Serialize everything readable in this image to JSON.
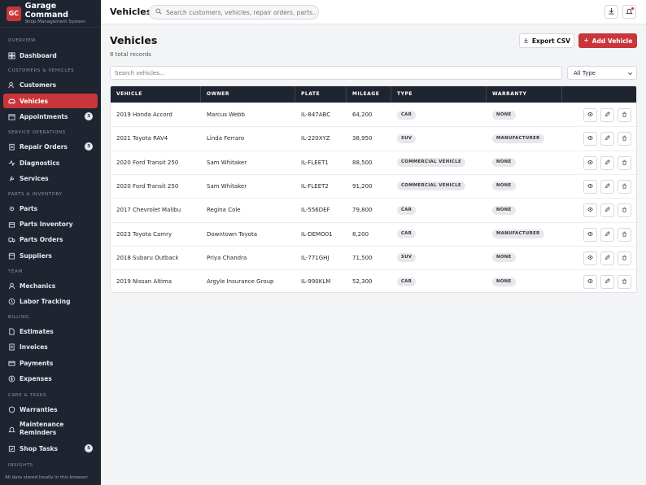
{
  "brand": {
    "logo": "GC",
    "title": "Garage Command",
    "subtitle": "Shop Management System"
  },
  "sidebar": {
    "sections": [
      "OVERVIEW",
      "CUSTOMERS & VEHICLES",
      "SERVICE OPERATIONS",
      "PARTS & INVENTORY",
      "TEAM",
      "BILLING",
      "CARE & TASKS",
      "INSIGHTS"
    ],
    "items": [
      {
        "label": "Dashboard",
        "icon": "dashboard-icon"
      },
      {
        "label": "Customers",
        "icon": "users-icon"
      },
      {
        "label": "Vehicles",
        "icon": "car-icon",
        "active": true
      },
      {
        "label": "Appointments",
        "icon": "calendar-icon",
        "badge": "3"
      },
      {
        "label": "Repair Orders",
        "icon": "clipboard-icon",
        "badge": "3"
      },
      {
        "label": "Diagnostics",
        "icon": "pulse-icon"
      },
      {
        "label": "Services",
        "icon": "wrench-icon"
      },
      {
        "label": "Parts",
        "icon": "gear-icon"
      },
      {
        "label": "Parts Inventory",
        "icon": "box-icon"
      },
      {
        "label": "Parts Orders",
        "icon": "truck-icon"
      },
      {
        "label": "Suppliers",
        "icon": "store-icon"
      },
      {
        "label": "Mechanics",
        "icon": "person-icon"
      },
      {
        "label": "Labor Tracking",
        "icon": "clock-icon"
      },
      {
        "label": "Estimates",
        "icon": "document-icon"
      },
      {
        "label": "Invoices",
        "icon": "invoice-icon"
      },
      {
        "label": "Payments",
        "icon": "card-icon"
      },
      {
        "label": "Expenses",
        "icon": "dollar-icon"
      },
      {
        "label": "Warranties",
        "icon": "shield-icon"
      },
      {
        "label": "Maintenance Reminders",
        "icon": "bell-icon"
      },
      {
        "label": "Shop Tasks",
        "icon": "checklist-icon",
        "badge": "5"
      }
    ],
    "footer": "All data stored locally in this browser."
  },
  "topbar": {
    "title": "Vehicles",
    "search_placeholder": "Search customers, vehicles, repair orders, parts..."
  },
  "main": {
    "title": "Vehicles",
    "records": "8 total records",
    "export_label": "Export CSV",
    "add_label": "Add Vehicle",
    "search_placeholder": "Search vehicles...",
    "type_filter": "All Type"
  },
  "table": {
    "headers": [
      "VEHICLE",
      "OWNER",
      "PLATE",
      "MILEAGE",
      "TYPE",
      "WARRANTY"
    ],
    "rows": [
      {
        "vehicle": "2019 Honda Accord",
        "owner": "Marcus Webb",
        "plate": "IL-847ABC",
        "mileage": "64,200",
        "type": "CAR",
        "warranty": "NONE"
      },
      {
        "vehicle": "2021 Toyota RAV4",
        "owner": "Linda Ferraro",
        "plate": "IL-220XYZ",
        "mileage": "38,950",
        "type": "SUV",
        "warranty": "MANUFACTURER"
      },
      {
        "vehicle": "2020 Ford Transit 250",
        "owner": "Sam Whitaker",
        "plate": "IL-FLEET1",
        "mileage": "88,500",
        "type": "COMMERCIAL VEHICLE",
        "warranty": "NONE"
      },
      {
        "vehicle": "2020 Ford Transit 250",
        "owner": "Sam Whitaker",
        "plate": "IL-FLEET2",
        "mileage": "91,200",
        "type": "COMMERCIAL VEHICLE",
        "warranty": "NONE"
      },
      {
        "vehicle": "2017 Chevrolet Malibu",
        "owner": "Regina Cole",
        "plate": "IL-556DEF",
        "mileage": "79,800",
        "type": "CAR",
        "warranty": "NONE"
      },
      {
        "vehicle": "2023 Toyota Camry",
        "owner": "Downtown Toyota",
        "plate": "IL-DEMO01",
        "mileage": "8,200",
        "type": "CAR",
        "warranty": "MANUFACTURER"
      },
      {
        "vehicle": "2018 Subaru Outback",
        "owner": "Priya Chandra",
        "plate": "IL-771GHJ",
        "mileage": "71,500",
        "type": "SUV",
        "warranty": "NONE"
      },
      {
        "vehicle": "2019 Nissan Altima",
        "owner": "Argyle Insurance Group",
        "plate": "IL-990KLM",
        "mileage": "52,300",
        "type": "CAR",
        "warranty": "NONE"
      }
    ]
  },
  "colors": {
    "accent": "#c8363b",
    "sidebar_bg": "#1f2530",
    "table_header_bg": "#1f2530"
  }
}
